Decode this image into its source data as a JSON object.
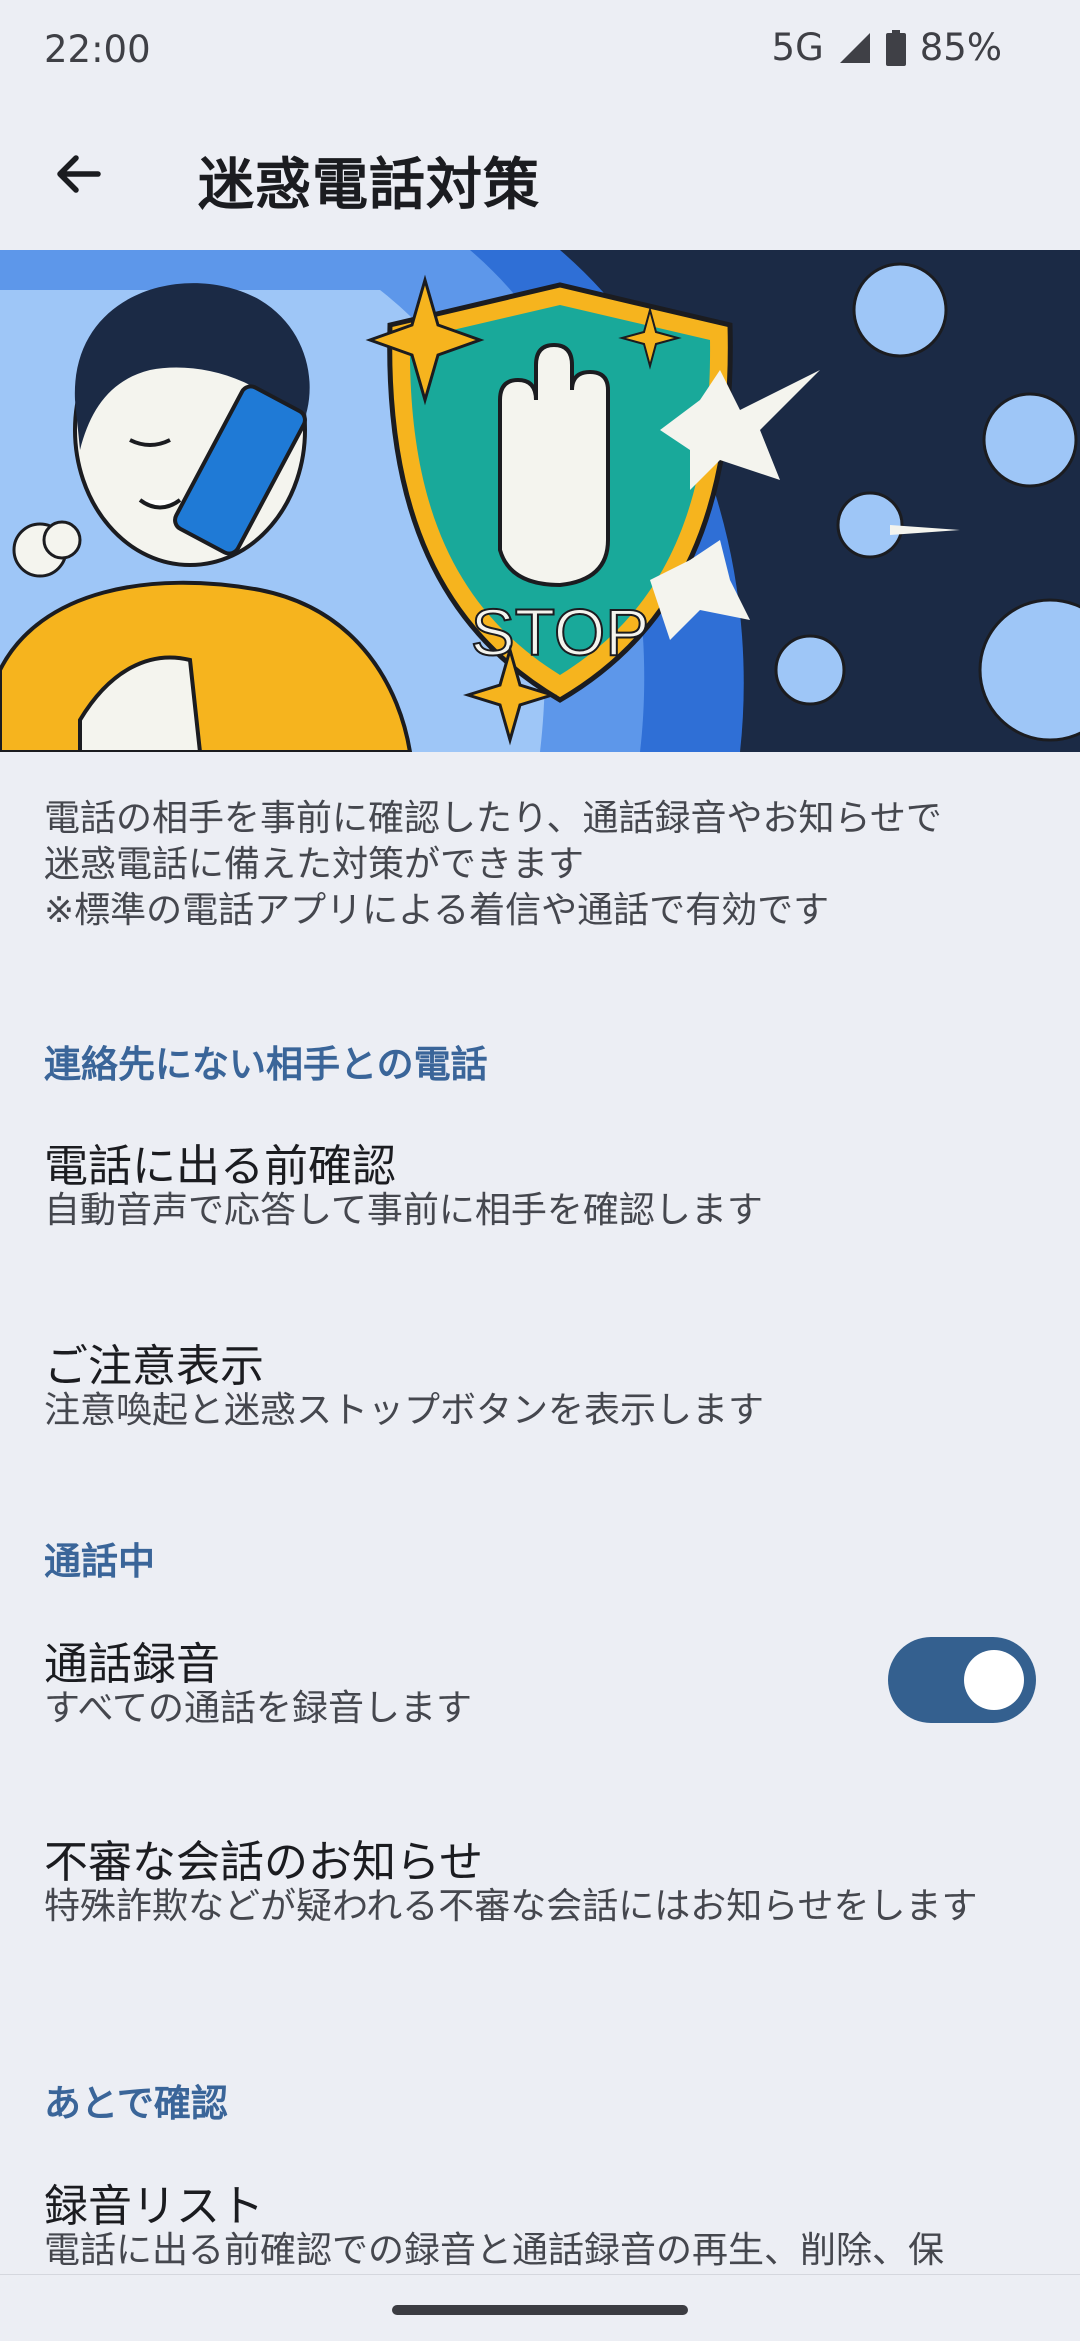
{
  "status": {
    "time": "22:00",
    "network": "5G",
    "battery": "85%",
    "icons": [
      "signal-icon",
      "battery-icon"
    ]
  },
  "appbar": {
    "title": "迷惑電話対策",
    "back_icon": "back-arrow-icon"
  },
  "hero": {
    "stop_label": "STOP"
  },
  "intro": {
    "line1": "電話の相手を事前に確認したり、通話録音やお知らせで",
    "line2": "迷惑電話に備えた対策ができます",
    "line3": "※標準の電話アプリによる着信や通話で有効です"
  },
  "sections": [
    {
      "header": "連絡先にない相手との電話",
      "items": [
        {
          "title": "電話に出る前確認",
          "subtitle": "自動音声で応答して事前に相手を確認します"
        },
        {
          "title": "ご注意表示",
          "subtitle": "注意喚起と迷惑ストップボタンを表示します"
        }
      ]
    },
    {
      "header": "通話中",
      "items": [
        {
          "title": "通話録音",
          "subtitle": "すべての通話を録音します",
          "toggle": true
        },
        {
          "title": "不審な会話のお知らせ",
          "subtitle": "特殊詐欺などが疑われる不審な会話にはお知らせをします"
        }
      ]
    },
    {
      "header": "あとで確認",
      "items": [
        {
          "title": "録音リスト",
          "subtitle": "電話に出る前確認での録音と通話録音の再生、削除、保"
        }
      ]
    }
  ],
  "colors": {
    "background": "#eceef4",
    "accent": "#3a6599",
    "toggle_on": "#34608f"
  }
}
